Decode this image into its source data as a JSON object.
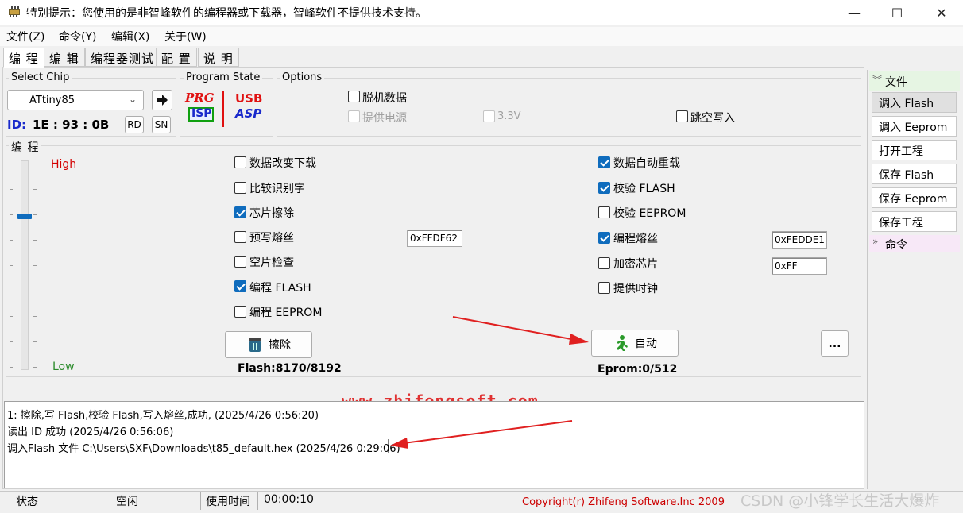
{
  "window": {
    "title": "特别提示：您使用的是非智峰软件的编程器或下载器，智峰软件不提供技术支持。",
    "minimize": "—",
    "maximize": "☐",
    "close": "✕"
  },
  "menu": [
    "文件(Z)",
    "命令(Y)",
    "编辑(X)",
    "关于(W)"
  ],
  "tabs": [
    "编 程",
    "编 辑",
    "编程器测试",
    "配 置",
    "说 明"
  ],
  "select_chip": {
    "label": "Select Chip",
    "chip": "ATtiny85",
    "id_label": "ID:",
    "id_value": "1E : 93 : 0B",
    "rd": "RD",
    "sn": "SN"
  },
  "program_state": {
    "label": "Program State",
    "prg": "PRG",
    "isp": "ISP",
    "usb": "USB",
    "asp": "ASP"
  },
  "options": {
    "label": "Options",
    "offline": "脱机数据",
    "power": "提供电源",
    "v33": "3.3V",
    "skip_blank": "跳空写入"
  },
  "program": {
    "label": "编 程",
    "high": "High",
    "low": "Low",
    "slider_level": 0.26,
    "left": [
      {
        "label": "数据改变下载",
        "checked": false
      },
      {
        "label": "比较识别字",
        "checked": false
      },
      {
        "label": "芯片擦除",
        "checked": true
      },
      {
        "label": "预写熔丝",
        "checked": false
      },
      {
        "label": "空片检查",
        "checked": false
      },
      {
        "label": "编程 FLASH",
        "checked": true
      },
      {
        "label": "编程 EEPROM",
        "checked": false
      }
    ],
    "right": [
      {
        "label": "数据自动重载",
        "checked": true
      },
      {
        "label": "校验 FLASH",
        "checked": true
      },
      {
        "label": "校验 EEPROM",
        "checked": false
      },
      {
        "label": "编程熔丝",
        "checked": true
      },
      {
        "label": "加密芯片",
        "checked": false
      },
      {
        "label": "提供时钟",
        "checked": false
      }
    ],
    "prewrite_fuse_value": "0xFFDF62",
    "fuse_value": "0xFEDDE1",
    "lock_value": "0xFF",
    "erase_button": "擦除",
    "auto_button": "自动",
    "more_button": "...",
    "flash_info": "Flash:8170/8192",
    "eprom_info": "Eprom:0/512"
  },
  "log": {
    "watermark": "www.zhifengsoft.com",
    "lines": [
      "1: 擦除,写 Flash,校验 Flash,写入熔丝,成功, (2025/4/26 0:56:20)",
      "读出 ID 成功 (2025/4/26 0:56:06)",
      "调入Flash 文件 C:\\Users\\SXF\\Downloads\\t85_default.hex (2025/4/26 0:29:06)"
    ]
  },
  "sidebar": {
    "file_header": "文件",
    "file_items": [
      "调入 Flash",
      "调入 Eeprom",
      "打开工程",
      "保存 Flash",
      "保存 Eeprom",
      "保存工程"
    ],
    "cmd_header": "命令"
  },
  "status": {
    "state_label": "状态",
    "state_value": "空闲",
    "time_label": "使用时间",
    "time_value": "00:00:10",
    "copyright": "Copyright(r) Zhifeng Software.Inc 2009",
    "csdn": "CSDN @小锋学长生活大爆炸"
  },
  "colors": {
    "accent": "#0f6cbd",
    "high": "#d40000",
    "low": "#2a8a2a",
    "copyright": "#cc0000",
    "arrow": "#e02020"
  }
}
